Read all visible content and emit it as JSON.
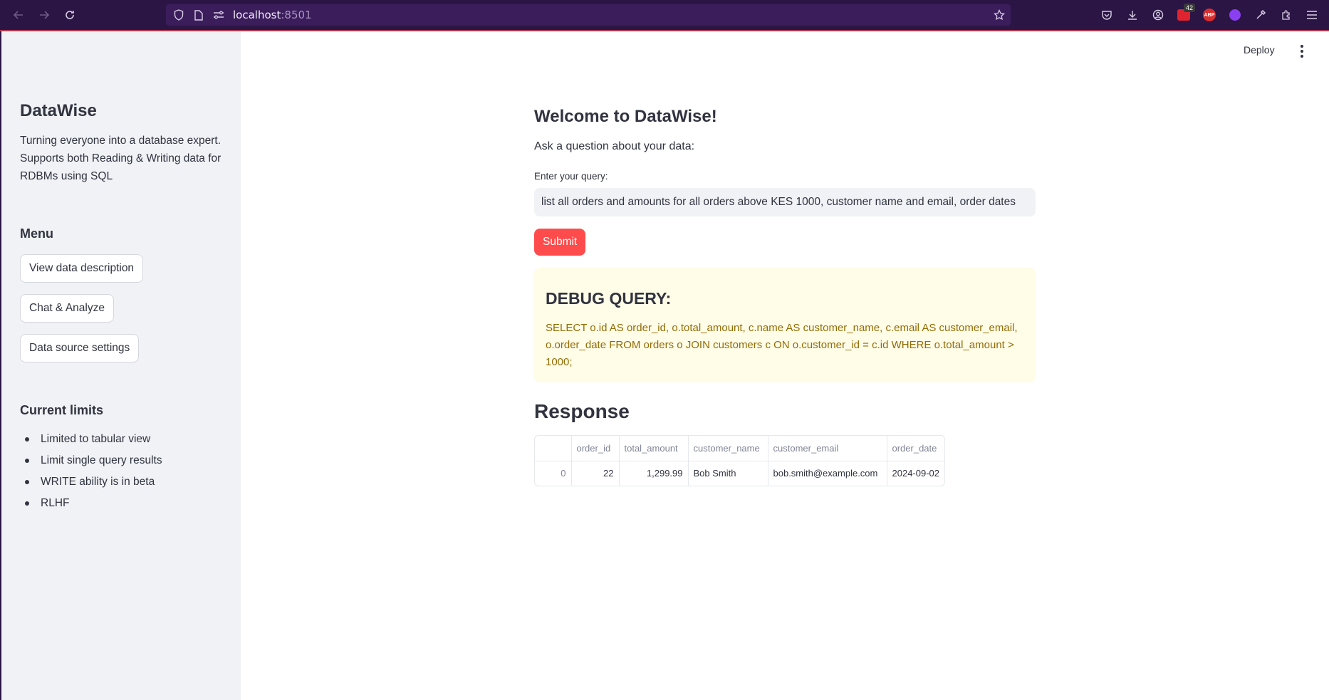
{
  "browser": {
    "url_host": "localhost",
    "url_port": ":8501",
    "ext_badge": "42",
    "abp_label": "ABP"
  },
  "sidebar": {
    "title": "DataWise",
    "description": "Turning everyone into a database expert. Supports both Reading & Writing data for RDBMs using SQL",
    "menu_heading": "Menu",
    "menu_buttons": [
      "View data description",
      "Chat & Analyze",
      "Data source settings"
    ],
    "limits_heading": "Current limits",
    "limits": [
      "Limited to tabular view",
      "Limit single query results",
      "WRITE ability is in beta",
      "RLHF"
    ]
  },
  "header": {
    "deploy_label": "Deploy"
  },
  "main": {
    "welcome": "Welcome to DataWise!",
    "ask_prompt": "Ask a question about your data:",
    "query_label": "Enter your query:",
    "query_value": "list all orders and amounts for all orders above KES 1000, customer name and email, order dates",
    "submit_label": "Submit",
    "debug_heading": "DEBUG QUERY:",
    "debug_sql": "SELECT o.id AS order_id, o.total_amount, c.name AS customer_name, c.email AS customer_email, o.order_date FROM orders o JOIN customers c ON o.customer_id = c.id WHERE o.total_amount > 1000;",
    "response_heading": "Response"
  },
  "table": {
    "columns": [
      "",
      "order_id",
      "total_amount",
      "customer_name",
      "customer_email",
      "order_date"
    ],
    "rows": [
      [
        "0",
        "22",
        "1,299.99",
        "Bob Smith",
        "bob.smith@example.com",
        "2024-09-02"
      ]
    ]
  },
  "colors": {
    "primary": "#ff4b4b",
    "browser_chrome": "#2b1544",
    "sidebar_bg": "#f0f2f6",
    "debug_bg": "#fffce7",
    "debug_text": "#926c05"
  }
}
